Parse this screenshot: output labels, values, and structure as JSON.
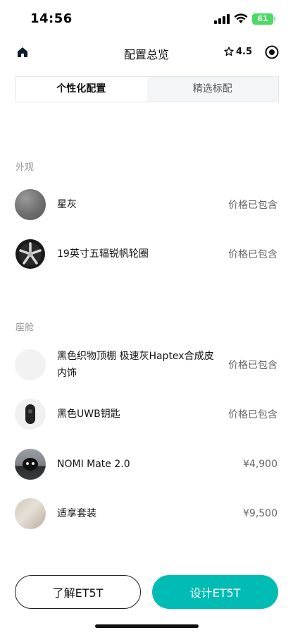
{
  "status_bar": {
    "time": "14:56",
    "battery": "61"
  },
  "nav": {
    "title": "配置总览",
    "rating": "4.5",
    "icons": [
      "home-icon",
      "star-icon",
      "target-icon"
    ]
  },
  "tabs": [
    {
      "label": "个性化配置",
      "active": true
    },
    {
      "label": "精选标配",
      "active": false
    }
  ],
  "sections": [
    {
      "title": "外观",
      "items": [
        {
          "name": "星灰",
          "price": "价格已包含",
          "thumb": "gray-paint-swatch"
        },
        {
          "name": "19英寸五辐锐帆轮圈",
          "price": "价格已包含",
          "thumb": "wheel-image"
        }
      ]
    },
    {
      "title": "座舱",
      "items": [
        {
          "name": "黑色织物顶棚 极速灰Haptex合成皮内饰",
          "price": "价格已包含",
          "thumb": "interior-swatch"
        },
        {
          "name": "黑色UWB钥匙",
          "price": "价格已包含",
          "thumb": "key-image"
        },
        {
          "name": "NOMI Mate 2.0",
          "price": "¥4,900",
          "thumb": "nomi-image"
        },
        {
          "name": "适享套装",
          "price": "¥9,500",
          "thumb": "package-image"
        }
      ]
    }
  ],
  "buttons": {
    "learn": "了解ET5T",
    "design": "设计ET5T"
  },
  "colors": {
    "accent": "#00bcb4",
    "battery": "#4cd964"
  }
}
